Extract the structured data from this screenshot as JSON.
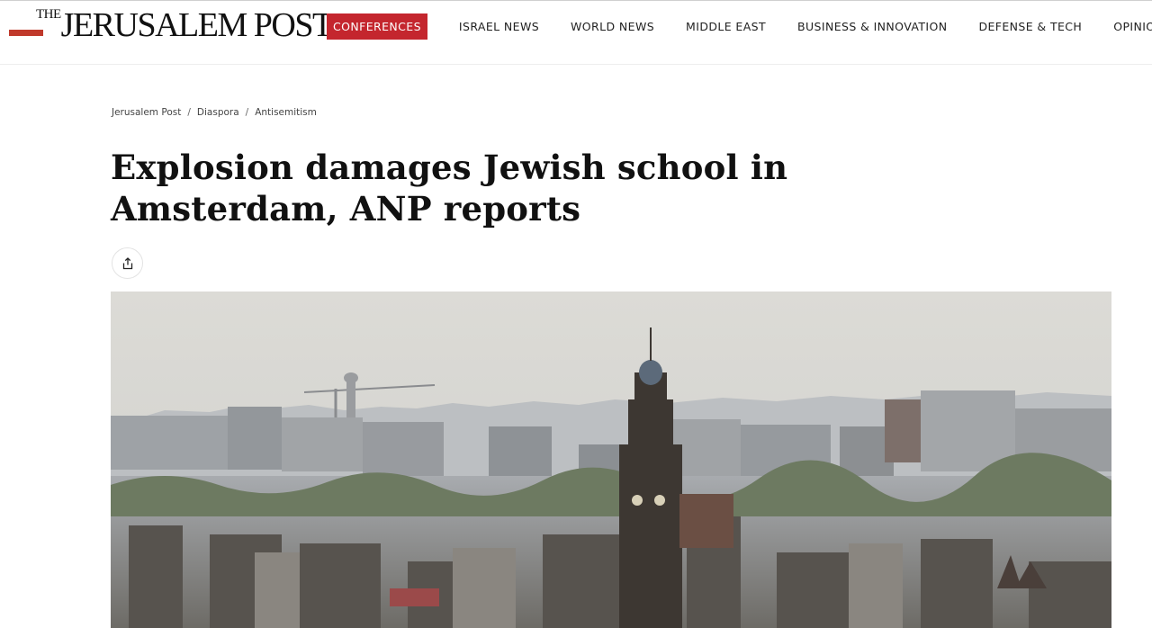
{
  "site": {
    "logo_the_top": "THE",
    "logo_word": "JERUSALEM POST",
    "brand_color": "#c4262e"
  },
  "nav": {
    "items": [
      {
        "label": "Conferences",
        "active": true
      },
      {
        "label": "Israel News",
        "active": false
      },
      {
        "label": "World News",
        "active": false
      },
      {
        "label": "Middle East",
        "active": false
      },
      {
        "label": "Business & Innovation",
        "active": false
      },
      {
        "label": "Defense & Tech",
        "active": false
      },
      {
        "label": "Opinion",
        "active": false
      }
    ]
  },
  "breadcrumb": {
    "items": [
      "Jerusalem Post",
      "Diaspora",
      "Antisemitism"
    ],
    "separator": "/"
  },
  "article": {
    "headline": "Explosion damages Jewish school in Amsterdam, ANP reports",
    "share_icon": "share-icon"
  },
  "hero_image": {
    "subject": "amsterdam-skyline-with-church-tower"
  }
}
